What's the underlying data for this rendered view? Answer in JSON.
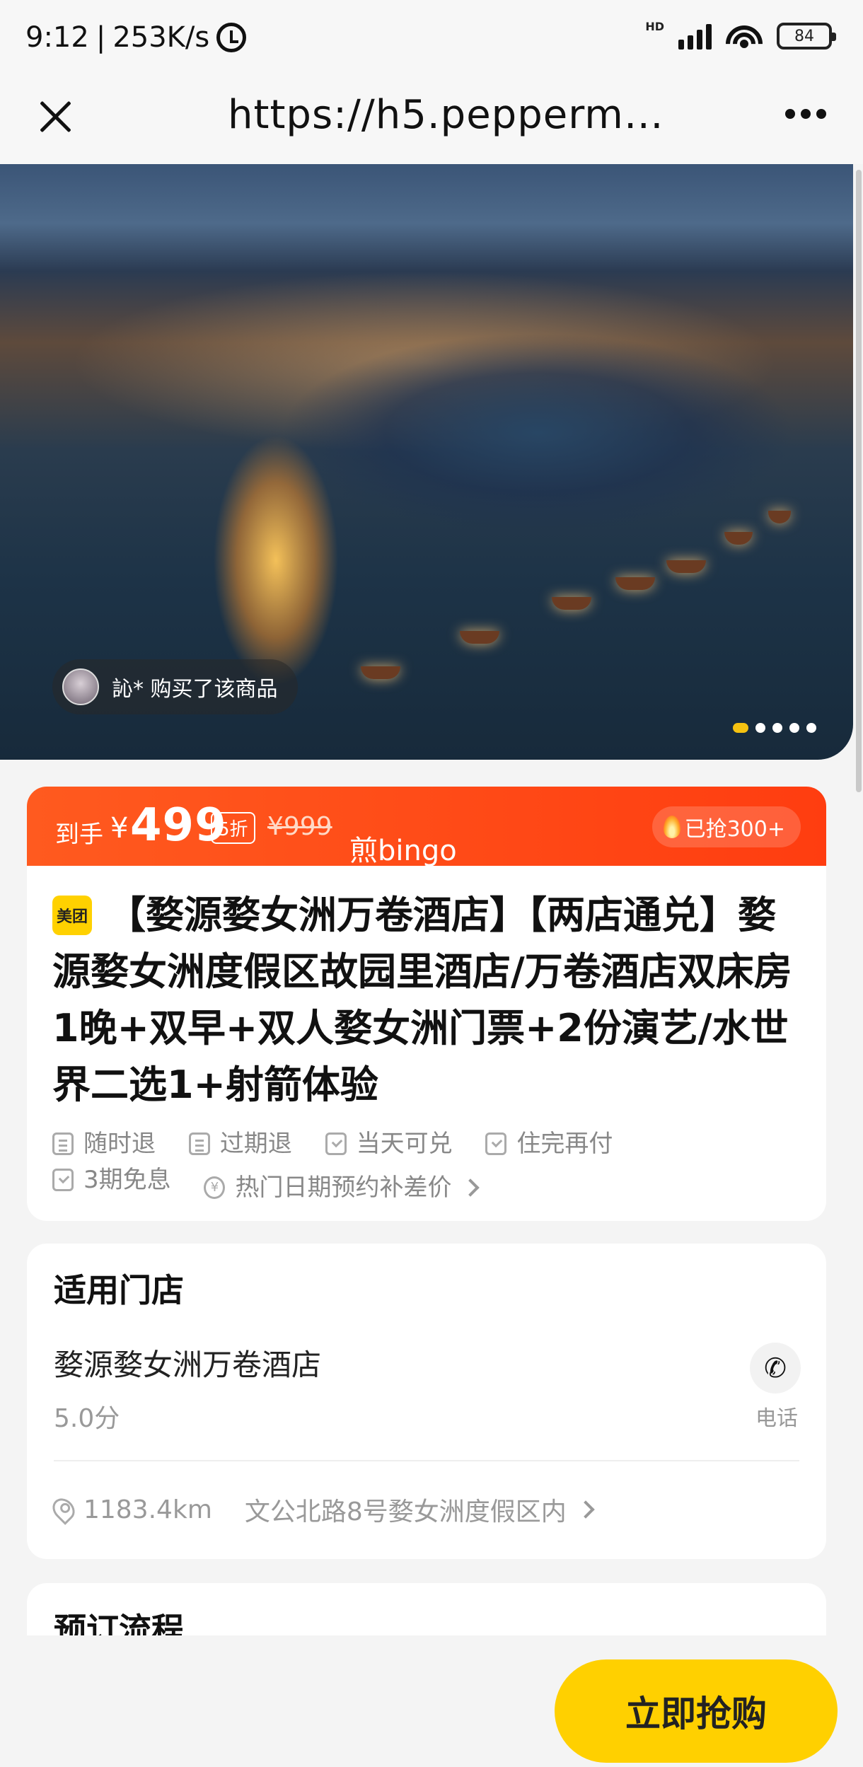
{
  "status_bar": {
    "time": "9:12",
    "speed": "253K/s",
    "hd": "HD",
    "battery": "84"
  },
  "nav": {
    "url": "https://h5.pepperm…"
  },
  "hero": {
    "buyer_text": "訫* 购买了该商品"
  },
  "price": {
    "label": "到手",
    "currency": "¥",
    "amount": "499",
    "discount": "5折",
    "original": "¥999",
    "brand": "煎bingo",
    "sold": "已抢300+"
  },
  "product": {
    "badge": "美团",
    "title": "【婺源婺女洲万卷酒店】【两店通兑】婺源婺女洲度假区故园里酒店/万卷酒店双床房1晚+双早+双人婺女洲门票+2份演艺/水世界二选1+射箭体验",
    "tags": [
      "随时退",
      "过期退",
      "当天可兑",
      "住完再付",
      "3期免息",
      "热门日期预约补差价"
    ]
  },
  "store": {
    "section_title": "适用门店",
    "name": "婺源婺女洲万卷酒店",
    "score": "5.0分",
    "phone_label": "电话",
    "distance": "1183.4km",
    "address": "文公北路8号婺女洲度假区内"
  },
  "booking": {
    "section_title": "预订流程"
  },
  "footer": {
    "buy_label": "立即抢购"
  },
  "colors": {
    "accent_orange": "#ff4a14",
    "buy_yellow": "#ffd000"
  }
}
